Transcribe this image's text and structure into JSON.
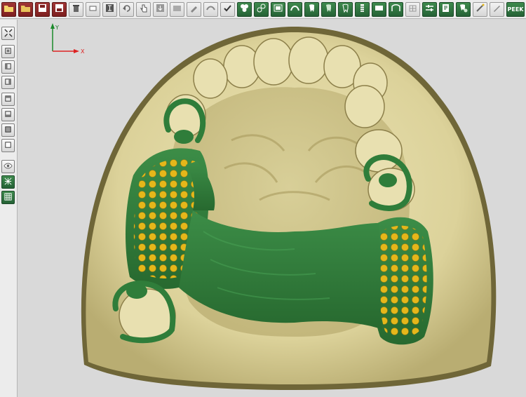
{
  "toolbar": {
    "buttons": [
      {
        "icon": "open-folder-icon",
        "style": "red"
      },
      {
        "icon": "folder-icon",
        "style": "red"
      },
      {
        "icon": "save-icon",
        "style": "red"
      },
      {
        "icon": "save-as-icon",
        "style": "red"
      },
      {
        "icon": "trash-icon",
        "style": "grey"
      },
      {
        "icon": "eraser-icon",
        "style": "grey"
      },
      {
        "icon": "text-cursor-icon",
        "style": "grey"
      },
      {
        "icon": "undo-icon",
        "style": "grey"
      },
      {
        "icon": "select-hand-icon",
        "style": "grey"
      },
      {
        "icon": "import-icon",
        "style": "grey"
      },
      {
        "icon": "surface-icon",
        "style": "grey"
      },
      {
        "icon": "brush-icon",
        "style": "grey"
      },
      {
        "icon": "smooth-icon",
        "style": "grey"
      },
      {
        "icon": "checkmark-icon",
        "style": "grey"
      },
      {
        "icon": "clasp-icon",
        "style": "green"
      },
      {
        "icon": "connector-icon",
        "style": "green"
      },
      {
        "icon": "frame-icon",
        "style": "green"
      },
      {
        "icon": "arch-icon",
        "style": "green"
      },
      {
        "icon": "tooth-icon",
        "style": "green"
      },
      {
        "icon": "tooth-alt-icon",
        "style": "green"
      },
      {
        "icon": "tooth-outline-icon",
        "style": "green"
      },
      {
        "icon": "mesh-strip-icon",
        "style": "green"
      },
      {
        "icon": "major-connector-icon",
        "style": "green"
      },
      {
        "icon": "finish-line-icon",
        "style": "green"
      },
      {
        "icon": "tooth-grid-icon",
        "style": "grey"
      },
      {
        "icon": "calibrate-icon",
        "style": "green"
      },
      {
        "icon": "export-icon",
        "style": "green"
      },
      {
        "icon": "tooth-export-icon",
        "style": "green"
      },
      {
        "icon": "wand-icon",
        "style": "grey"
      },
      {
        "icon": "pen-icon",
        "style": "grey"
      }
    ],
    "peek_label": "PEEK"
  },
  "sidebar": {
    "buttons": [
      {
        "icon": "fit-view-icon",
        "style": "grey"
      },
      {
        "icon": "view-front-icon",
        "style": "grey"
      },
      {
        "icon": "view-back-icon",
        "style": "grey"
      },
      {
        "icon": "view-left-icon",
        "style": "grey"
      },
      {
        "icon": "view-right-icon",
        "style": "grey"
      },
      {
        "icon": "view-top-icon",
        "style": "grey"
      },
      {
        "icon": "view-bottom-icon",
        "style": "grey"
      },
      {
        "icon": "view-iso-icon",
        "style": "grey"
      },
      {
        "icon": "eye-icon",
        "style": "grey"
      },
      {
        "icon": "wireframe-icon",
        "style": "green"
      },
      {
        "icon": "grid-icon",
        "style": "green"
      }
    ]
  },
  "axis": {
    "x_label": "X",
    "y_label": "Y"
  },
  "colors": {
    "model": "#e2d9a2",
    "model_shadow": "#8f8455",
    "framework": "#2f7d3a",
    "framework_light": "#4aa356",
    "retention_dots": "#e5b71a",
    "background": "#d9d9d9"
  }
}
